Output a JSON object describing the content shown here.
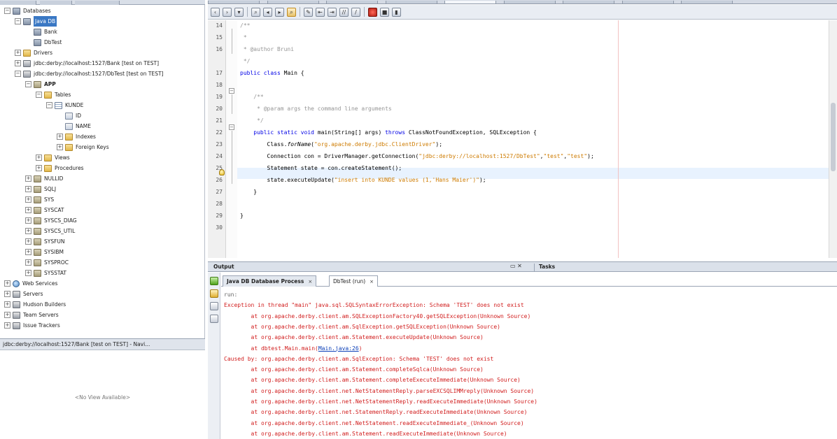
{
  "left_panel": {
    "tree": [
      {
        "label": "Databases",
        "icon": "databases-icon",
        "toggle": "−",
        "depth": 0,
        "kind": "db"
      },
      {
        "label": "Java DB",
        "icon": "javadb-icon",
        "toggle": "−",
        "depth": 1,
        "kind": "db",
        "selected": true
      },
      {
        "label": "Bank",
        "icon": "database-icon",
        "toggle": "",
        "depth": 2,
        "kind": "db"
      },
      {
        "label": "DbTest",
        "icon": "database-icon",
        "toggle": "",
        "depth": 2,
        "kind": "db"
      },
      {
        "label": "Drivers",
        "icon": "folder-icon",
        "toggle": "+",
        "depth": 1,
        "kind": "folder"
      },
      {
        "label": "jdbc:derby://localhost:1527/Bank [test on TEST]",
        "icon": "connection-icon",
        "toggle": "+",
        "depth": 1,
        "kind": "conn"
      },
      {
        "label": "jdbc:derby://localhost:1527/DbTest [test on TEST]",
        "icon": "connection-icon",
        "toggle": "−",
        "depth": 1,
        "kind": "conn"
      },
      {
        "label": "APP",
        "icon": "schema-icon",
        "toggle": "−",
        "depth": 2,
        "kind": "schema",
        "bold": true
      },
      {
        "label": "Tables",
        "icon": "folder-icon",
        "toggle": "−",
        "depth": 3,
        "kind": "folder"
      },
      {
        "label": "KUNDE",
        "icon": "table-icon",
        "toggle": "−",
        "depth": 4,
        "kind": "table"
      },
      {
        "label": "ID",
        "icon": "column-icon",
        "toggle": "",
        "depth": 5,
        "kind": "col"
      },
      {
        "label": "NAME",
        "icon": "column-icon",
        "toggle": "",
        "depth": 5,
        "kind": "col"
      },
      {
        "label": "Indexes",
        "icon": "folder-icon",
        "toggle": "+",
        "depth": 5,
        "kind": "folder"
      },
      {
        "label": "Foreign Keys",
        "icon": "folder-icon",
        "toggle": "+",
        "depth": 5,
        "kind": "folder"
      },
      {
        "label": "Views",
        "icon": "folder-icon",
        "toggle": "+",
        "depth": 3,
        "kind": "folder"
      },
      {
        "label": "Procedures",
        "icon": "folder-icon",
        "toggle": "+",
        "depth": 3,
        "kind": "folder"
      },
      {
        "label": "NULLID",
        "icon": "schema-icon",
        "toggle": "+",
        "depth": 2,
        "kind": "schema"
      },
      {
        "label": "SQLJ",
        "icon": "schema-icon",
        "toggle": "+",
        "depth": 2,
        "kind": "schema"
      },
      {
        "label": "SYS",
        "icon": "schema-icon",
        "toggle": "+",
        "depth": 2,
        "kind": "schema"
      },
      {
        "label": "SYSCAT",
        "icon": "schema-icon",
        "toggle": "+",
        "depth": 2,
        "kind": "schema"
      },
      {
        "label": "SYSCS_DIAG",
        "icon": "schema-icon",
        "toggle": "+",
        "depth": 2,
        "kind": "schema"
      },
      {
        "label": "SYSCS_UTIL",
        "icon": "schema-icon",
        "toggle": "+",
        "depth": 2,
        "kind": "schema"
      },
      {
        "label": "SYSFUN",
        "icon": "schema-icon",
        "toggle": "+",
        "depth": 2,
        "kind": "schema"
      },
      {
        "label": "SYSIBM",
        "icon": "schema-icon",
        "toggle": "+",
        "depth": 2,
        "kind": "schema"
      },
      {
        "label": "SYSPROC",
        "icon": "schema-icon",
        "toggle": "+",
        "depth": 2,
        "kind": "schema"
      },
      {
        "label": "SYSSTAT",
        "icon": "schema-icon",
        "toggle": "+",
        "depth": 2,
        "kind": "schema"
      },
      {
        "label": "Web Services",
        "icon": "globe-icon",
        "toggle": "+",
        "depth": 0,
        "kind": "globe"
      },
      {
        "label": "Servers",
        "icon": "server-icon",
        "toggle": "+",
        "depth": 0,
        "kind": "conn"
      },
      {
        "label": "Hudson Builders",
        "icon": "hudson-icon",
        "toggle": "+",
        "depth": 0,
        "kind": "conn"
      },
      {
        "label": "Team Servers",
        "icon": "team-server-icon",
        "toggle": "+",
        "depth": 0,
        "kind": "conn"
      },
      {
        "label": "Issue Trackers",
        "icon": "bug-icon",
        "toggle": "+",
        "depth": 0,
        "kind": "conn"
      }
    ],
    "navigator_title": "jdbc:derby://localhost:1527/Bank [test on TEST] - Navi...",
    "navigator_empty": "<No View Available>"
  },
  "toolbar": {
    "buttons": [
      "back-icon",
      "forward-icon",
      "dropdown-icon",
      "find-icon",
      "find-previous-icon",
      "find-next-icon",
      "find-selection-icon",
      "toggle-highlight-icon",
      "shift-left-icon",
      "shift-right-icon",
      "comment-icon",
      "uncomment-icon",
      "record-macro-icon",
      "stop-macro-icon",
      "run-icon"
    ]
  },
  "editor": {
    "lines": [
      {
        "n": "14",
        "tokens": [
          {
            "t": "/**",
            "c": "cm"
          }
        ]
      },
      {
        "n": "15",
        "tokens": [
          {
            "t": " *",
            "c": "cm"
          }
        ]
      },
      {
        "n": "16",
        "tokens": [
          {
            "t": " * @author Bruni",
            "c": "cm"
          }
        ]
      },
      {
        "n": "",
        "tokens": [
          {
            "t": " */",
            "c": "cm"
          }
        ]
      },
      {
        "n": "17",
        "tokens": [
          {
            "t": "public class ",
            "c": "kw"
          },
          {
            "t": "Main {",
            "c": ""
          }
        ]
      },
      {
        "n": "18",
        "tokens": []
      },
      {
        "n": "19",
        "tokens": [
          {
            "t": "    /**",
            "c": "cm"
          }
        ]
      },
      {
        "n": "20",
        "tokens": [
          {
            "t": "     * @param args the command line arguments",
            "c": "cm"
          }
        ]
      },
      {
        "n": "21",
        "tokens": [
          {
            "t": "     */",
            "c": "cm"
          }
        ]
      },
      {
        "n": "22",
        "tokens": [
          {
            "t": "    public static void ",
            "c": "kw"
          },
          {
            "t": "main(String[] args) ",
            "c": ""
          },
          {
            "t": "throws ",
            "c": "kw"
          },
          {
            "t": "ClassNotFoundException, SQLException {",
            "c": ""
          }
        ]
      },
      {
        "n": "23",
        "tokens": [
          {
            "t": "        Class.",
            "c": ""
          },
          {
            "t": "forName",
            "c": "it"
          },
          {
            "t": "(",
            "c": ""
          },
          {
            "t": "\"org.apache.derby.jdbc.ClientDriver\"",
            "c": "str"
          },
          {
            "t": ");",
            "c": ""
          }
        ]
      },
      {
        "n": "24",
        "tokens": [
          {
            "t": "        Connection con = DriverManager.getConnection(",
            "c": ""
          },
          {
            "t": "\"jdbc:derby://localhost:1527/DbTest\"",
            "c": "str"
          },
          {
            "t": ",",
            "c": ""
          },
          {
            "t": "\"test\"",
            "c": "str"
          },
          {
            "t": ",",
            "c": ""
          },
          {
            "t": "\"test\"",
            "c": "str"
          },
          {
            "t": ");",
            "c": ""
          }
        ]
      },
      {
        "n": "25",
        "tokens": [
          {
            "t": "        Statement state = con.createStatement();",
            "c": ""
          }
        ]
      },
      {
        "n": "26",
        "tokens": [
          {
            "t": "        state.executeUpdate(",
            "c": ""
          },
          {
            "t": "\"insert into KUNDE values (1,'Hans Maier')\"",
            "c": "str"
          },
          {
            "t": ");",
            "c": ""
          }
        ]
      },
      {
        "n": "27",
        "tokens": [
          {
            "t": "    }",
            "c": ""
          }
        ]
      },
      {
        "n": "28",
        "tokens": []
      },
      {
        "n": "29",
        "tokens": [
          {
            "t": "}",
            "c": ""
          }
        ]
      },
      {
        "n": "30",
        "tokens": []
      }
    ]
  },
  "output": {
    "panel_title": "Output",
    "tasks_title": "Tasks",
    "controls": "▭ ✕",
    "tabs": [
      {
        "label": "Java DB Database Process",
        "close": "×"
      },
      {
        "label": "DbTest (run)",
        "close": "×"
      }
    ],
    "lines": [
      {
        "text": "run:",
        "kind": "run"
      },
      {
        "text": "Exception in thread \"main\" java.sql.SQLSyntaxErrorException: Schema 'TEST' does not exist",
        "kind": "err"
      },
      {
        "text": "        at org.apache.derby.client.am.SQLExceptionFactory40.getSQLException(Unknown Source)",
        "kind": "err"
      },
      {
        "text": "        at org.apache.derby.client.am.SqlException.getSQLException(Unknown Source)",
        "kind": "err"
      },
      {
        "text": "        at org.apache.derby.client.am.Statement.executeUpdate(Unknown Source)",
        "kind": "err"
      },
      {
        "text": "        at dbtest.Main.main(",
        "kind": "err",
        "link": "Main.java:26",
        "tail": ")"
      },
      {
        "text": "Caused by: org.apache.derby.client.am.SqlException: Schema 'TEST' does not exist",
        "kind": "err"
      },
      {
        "text": "        at org.apache.derby.client.am.Statement.completeSqlca(Unknown Source)",
        "kind": "err"
      },
      {
        "text": "        at org.apache.derby.client.am.Statement.completeExecuteImmediate(Unknown Source)",
        "kind": "err"
      },
      {
        "text": "        at org.apache.derby.client.net.NetStatementReply.parseEXCSQLIMMreply(Unknown Source)",
        "kind": "err"
      },
      {
        "text": "        at org.apache.derby.client.net.NetStatementReply.readExecuteImmediate(Unknown Source)",
        "kind": "err"
      },
      {
        "text": "        at org.apache.derby.client.net.StatementReply.readExecuteImmediate(Unknown Source)",
        "kind": "err"
      },
      {
        "text": "        at org.apache.derby.client.net.NetStatement.readExecuteImmediate_(Unknown Source)",
        "kind": "err"
      },
      {
        "text": "        at org.apache.derby.client.am.Statement.readExecuteImmediate(Unknown Source)",
        "kind": "err"
      }
    ]
  },
  "colors": {
    "keyword": "#0000e6",
    "string": "#ce7b00",
    "comment": "#969696",
    "error_text": "#d11d1d",
    "selection": "#3a78c4",
    "current_line": "#e8f2fe"
  }
}
